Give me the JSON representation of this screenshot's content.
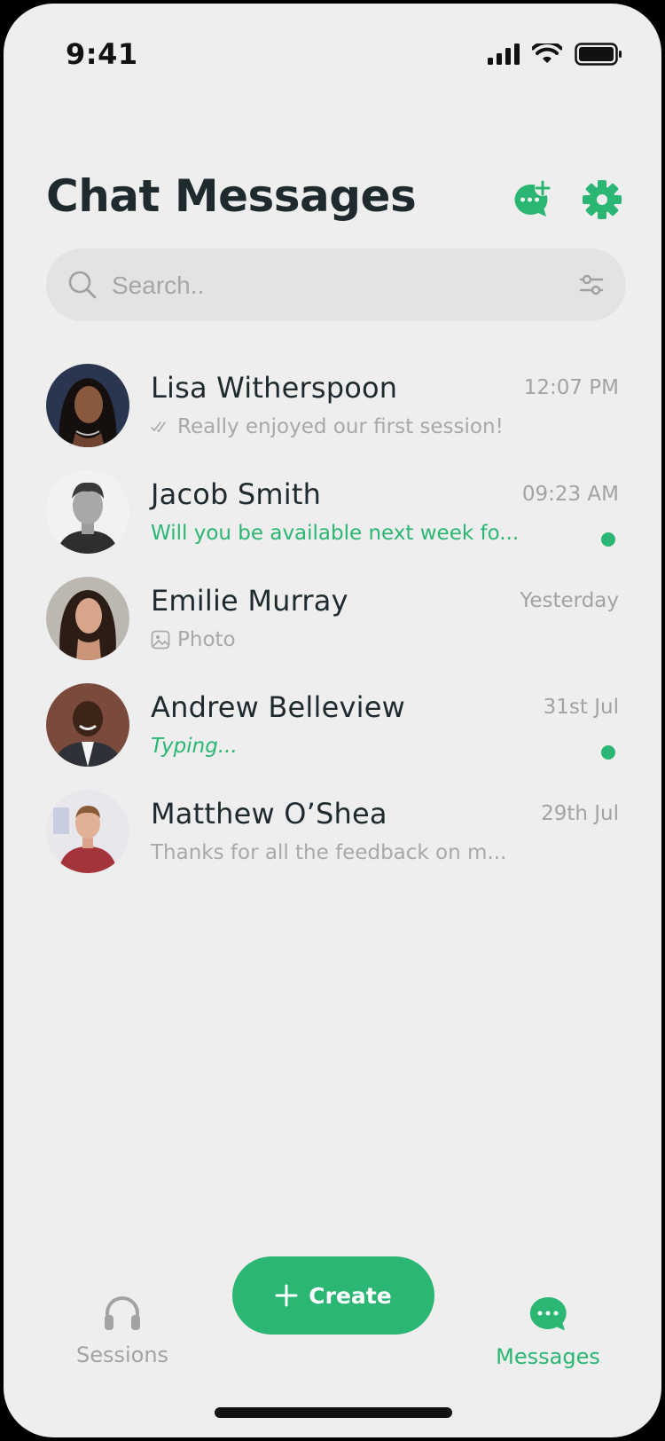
{
  "status_bar": {
    "time": "9:41"
  },
  "header": {
    "title": "Chat Messages"
  },
  "search": {
    "placeholder": "Search.."
  },
  "chats": [
    {
      "name": "Lisa Witherspoon",
      "time": "12:07 PM",
      "preview": "Really enjoyed our first session!",
      "preview_icon": "double-check-icon",
      "unread": false
    },
    {
      "name": "Jacob Smith",
      "time": "09:23 AM",
      "preview": "Will you be available next week fo...",
      "unread": true
    },
    {
      "name": "Emilie Murray",
      "time": "Yesterday",
      "preview": "Photo",
      "preview_icon": "photo-icon",
      "unread": false
    },
    {
      "name": "Andrew Belleview",
      "time": "31st Jul",
      "preview": "Typing...",
      "unread": true
    },
    {
      "name": "Matthew O’Shea",
      "time": "29th Jul",
      "preview": "Thanks for all the feedback on m...",
      "unread": false
    }
  ],
  "bottom_nav": {
    "sessions_label": "Sessions",
    "create_label": "Create",
    "messages_label": "Messages",
    "active": "Messages"
  },
  "colors": {
    "accent": "#2BB673",
    "background": "#EEEEEE",
    "title": "#1F2A2E",
    "muted": "#A6A6A6"
  }
}
